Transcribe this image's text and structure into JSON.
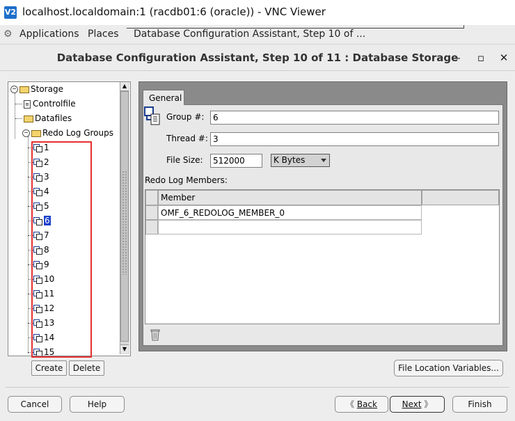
{
  "vnc": {
    "logo": "V2",
    "title": "localhost.localdomain:1 (racdb01:6 (oracle)) - VNC Viewer"
  },
  "panel": {
    "applications": "Applications",
    "places": "Places",
    "task": "Database Configuration Assistant, Step 10 of ..."
  },
  "window": {
    "title": "Database Configuration Assistant, Step 10 of 11 : Database Storage",
    "minimize": "–",
    "maximize": "▫",
    "close": "✕"
  },
  "tree": {
    "root": "Storage",
    "controlfile": "Controlfile",
    "datafiles": "Datafiles",
    "redo_groups": "Redo Log Groups",
    "groups": [
      "1",
      "2",
      "3",
      "4",
      "5",
      "6",
      "7",
      "8",
      "9",
      "10",
      "11",
      "12",
      "13",
      "14",
      "15"
    ],
    "selected": "6"
  },
  "tree_buttons": {
    "create": "Create",
    "delete": "Delete"
  },
  "tab": {
    "label": "General"
  },
  "form": {
    "group_label": "Group #:",
    "group_value": "6",
    "thread_label": "Thread #:",
    "thread_value": "3",
    "filesize_label": "File Size:",
    "filesize_value": "512000",
    "unit_value": "K Bytes"
  },
  "members": {
    "label": "Redo Log Members:",
    "column": "Member",
    "rows": [
      "OMF_6_REDOLOG_MEMBER_0",
      ""
    ]
  },
  "file_location_button": "File Location Variables...",
  "footer": {
    "cancel": "Cancel",
    "help": "Help",
    "back": "Back",
    "next": "Next",
    "finish": "Finish"
  },
  "icons": {
    "back": "chevron-left-icon",
    "next": "chevron-right-icon",
    "trash": "trash-icon"
  }
}
